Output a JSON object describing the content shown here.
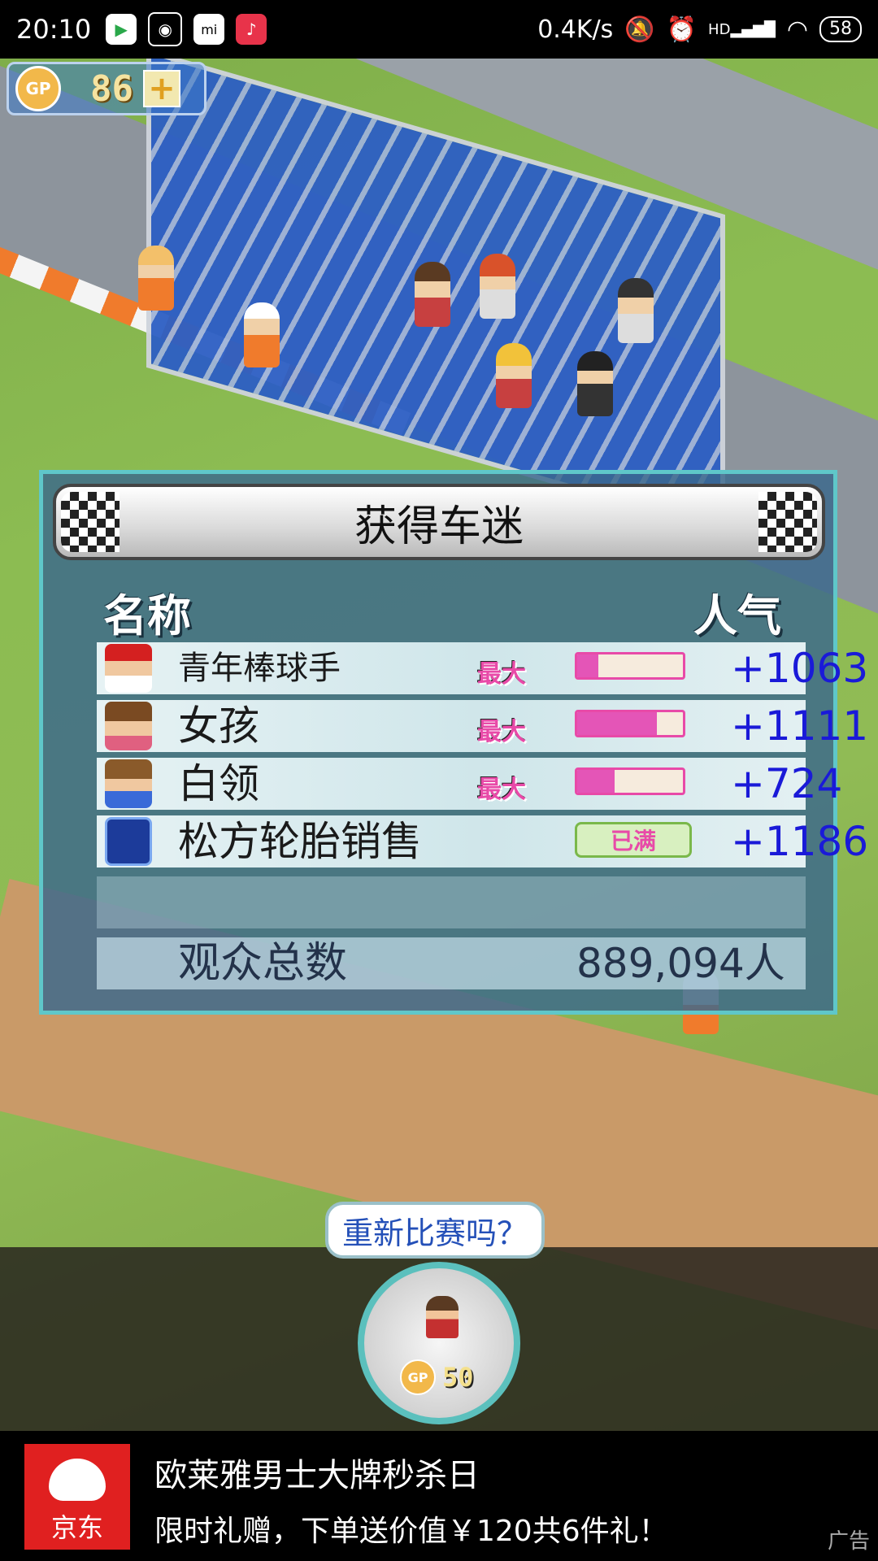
{
  "status_bar": {
    "time": "20:10",
    "network_speed": "0.4K/s",
    "battery": "58",
    "signal_label": "HD"
  },
  "hud": {
    "gp_coin_label": "GP",
    "gp_value": "86",
    "add_label": "+"
  },
  "dialog": {
    "title": "获得车迷",
    "col_name": "名称",
    "col_popularity": "人气",
    "max_label": "最大",
    "full_label": "已满",
    "rows": [
      {
        "name": "青年棒球手",
        "bar_level": 0.2,
        "popularity": "+1063",
        "status": "max"
      },
      {
        "name": "女孩",
        "bar_level": 0.75,
        "popularity": "+1111",
        "status": "max"
      },
      {
        "name": "白领",
        "bar_level": 0.35,
        "popularity": "+724",
        "status": "max"
      },
      {
        "name": "松方轮胎销售",
        "popularity": "+1186",
        "status": "full"
      }
    ],
    "total_label": "观众总数",
    "total_value": "889,094人"
  },
  "restart": {
    "prompt": "重新比赛吗？",
    "coin_label": "GP",
    "cost": "50"
  },
  "ad": {
    "logo_text": "京东",
    "title": "欧莱雅男士大牌秒杀日",
    "subtitle": "限时礼赠，下单送价值￥120共6件礼！",
    "tag": "广告"
  }
}
